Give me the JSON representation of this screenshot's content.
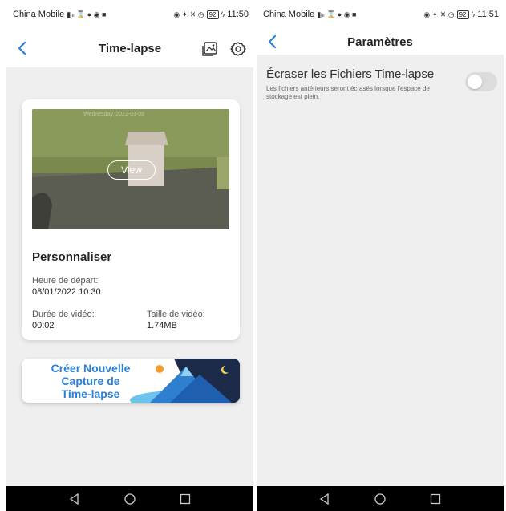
{
  "left_screen": {
    "status_bar": {
      "carrier": "China Mobile",
      "battery": "92",
      "time": "11:50"
    },
    "header": {
      "title": "Time-lapse"
    },
    "card": {
      "thumb_overlay_text": "Wednesday, 2022-03-08",
      "view_label": "View",
      "title": "Personnaliser",
      "start_label": "Heure de départ:",
      "start_value": "08/01/2022 10:30",
      "duration_label": "Durée de vidéo:",
      "duration_value": "00:02",
      "size_label": "Taille de vidéo:",
      "size_value": "1.74MB"
    },
    "create_banner": {
      "line1": "Créer Nouvelle",
      "line2": "Capture de",
      "line3": "Time-lapse"
    }
  },
  "right_screen": {
    "status_bar": {
      "carrier": "China Mobile",
      "battery": "92",
      "time": "11:51"
    },
    "header": {
      "title": "Paramètres"
    },
    "setting": {
      "title": "Écraser les Fichiers Time-lapse",
      "description": "Les fichiers antérieurs seront écrasés lorsque l'espace de stockage est plein.",
      "enabled": false
    }
  },
  "colors": {
    "accent": "#2b7fd4",
    "background": "#efefef",
    "nav_bar": "#000000",
    "toggle_off": "#dcdcdc"
  },
  "icons": {
    "back": "chevron-left-icon",
    "gallery": "gallery-icon",
    "settings": "gear-icon",
    "nav_back": "triangle-back-icon",
    "nav_home": "circle-home-icon",
    "nav_recent": "square-recent-icon"
  }
}
